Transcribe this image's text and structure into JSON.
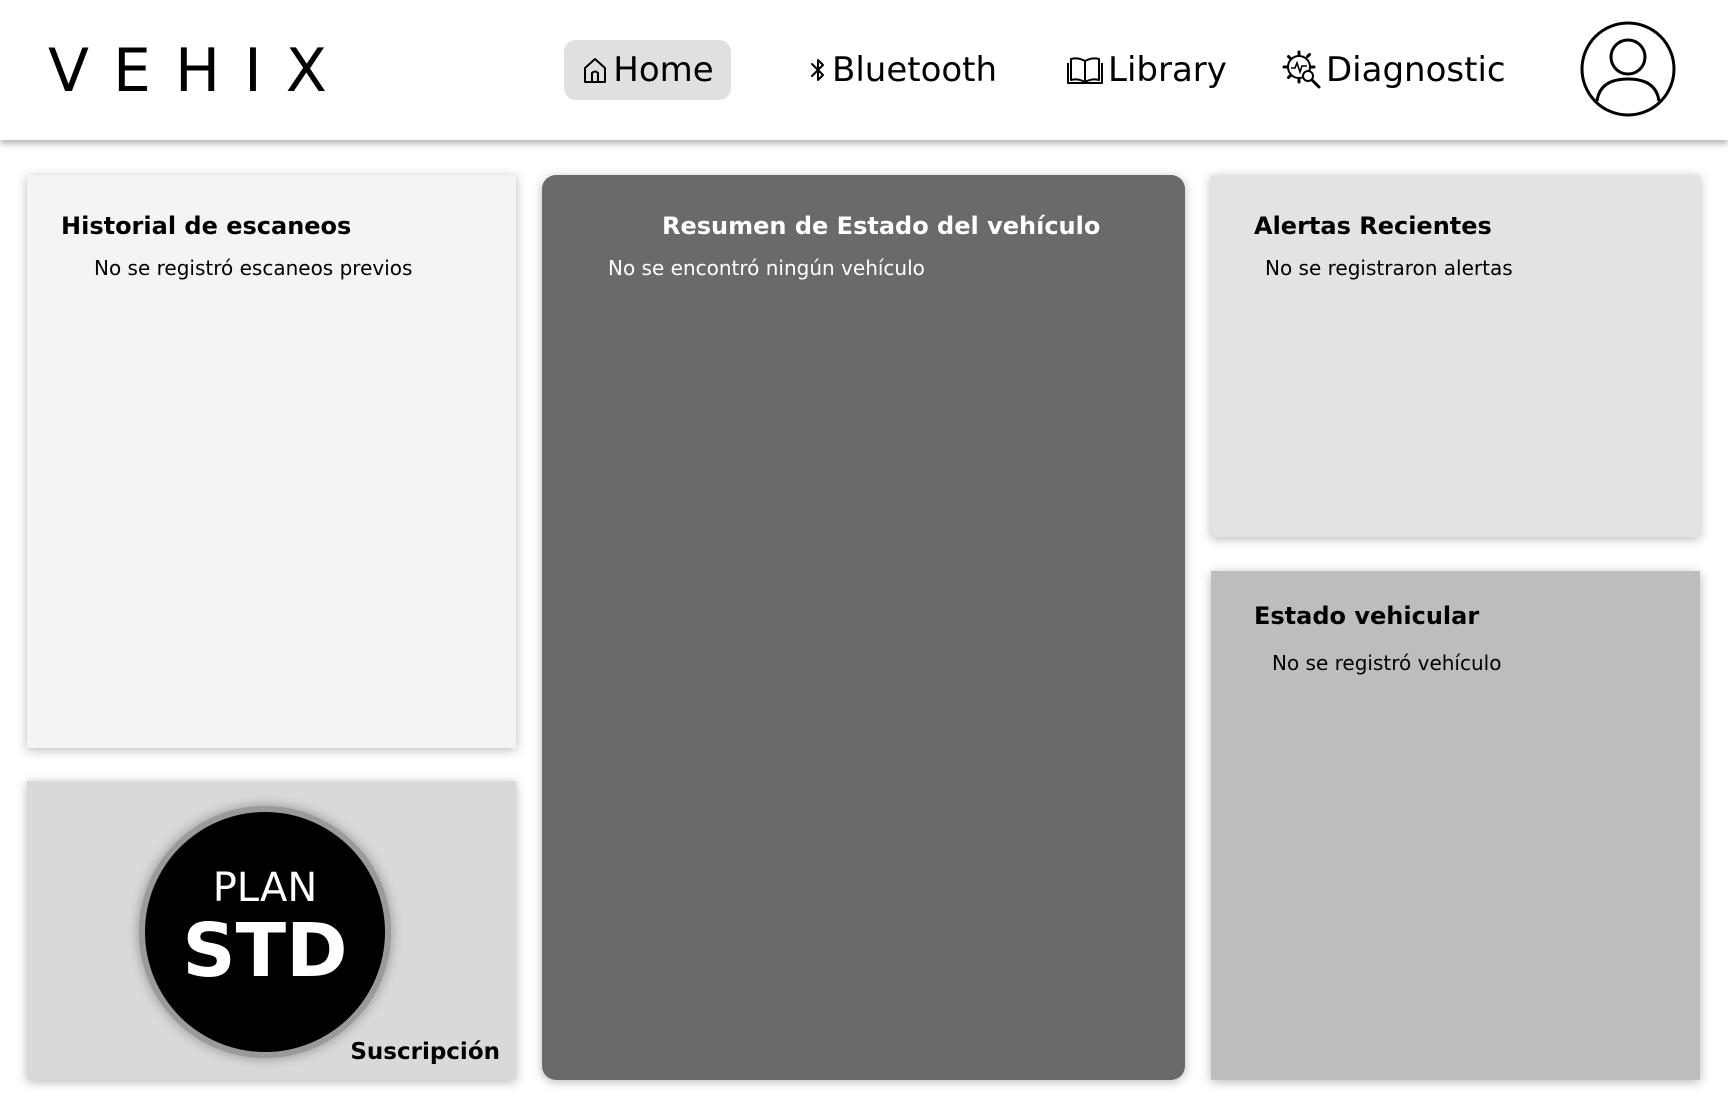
{
  "app": {
    "logo_text": "VEHIX"
  },
  "nav": {
    "items": [
      {
        "label": "Home",
        "icon": "home-icon",
        "active": true
      },
      {
        "label": "Bluetooth",
        "icon": "bluetooth-icon",
        "active": false
      },
      {
        "label": "Library",
        "icon": "book-icon",
        "active": false
      },
      {
        "label": "Diagnostic",
        "icon": "diagnostic-gear-icon",
        "active": false
      }
    ],
    "active_bg": "#e0e0e0"
  },
  "user": {
    "avatar_icon": "user-avatar-icon"
  },
  "cards": {
    "history": {
      "title": "Historial de escaneos",
      "message": "No se registró escaneos previos",
      "bg": "#f4f4f4"
    },
    "summary": {
      "title": "Resumen de Estado del vehículo",
      "message": "No se encontró ningún vehículo",
      "bg": "#6a6a6a"
    },
    "alerts": {
      "title": "Alertas Recientes",
      "message": "No se registraron alertas",
      "bg": "#e3e3e3"
    },
    "status": {
      "title": "Estado vehicular",
      "message": "No se registró vehículo",
      "bg": "#bdbdbd"
    },
    "plan": {
      "label": "PLAN",
      "code": "STD",
      "caption": "Suscripción",
      "bg": "#d9d9d9"
    }
  }
}
